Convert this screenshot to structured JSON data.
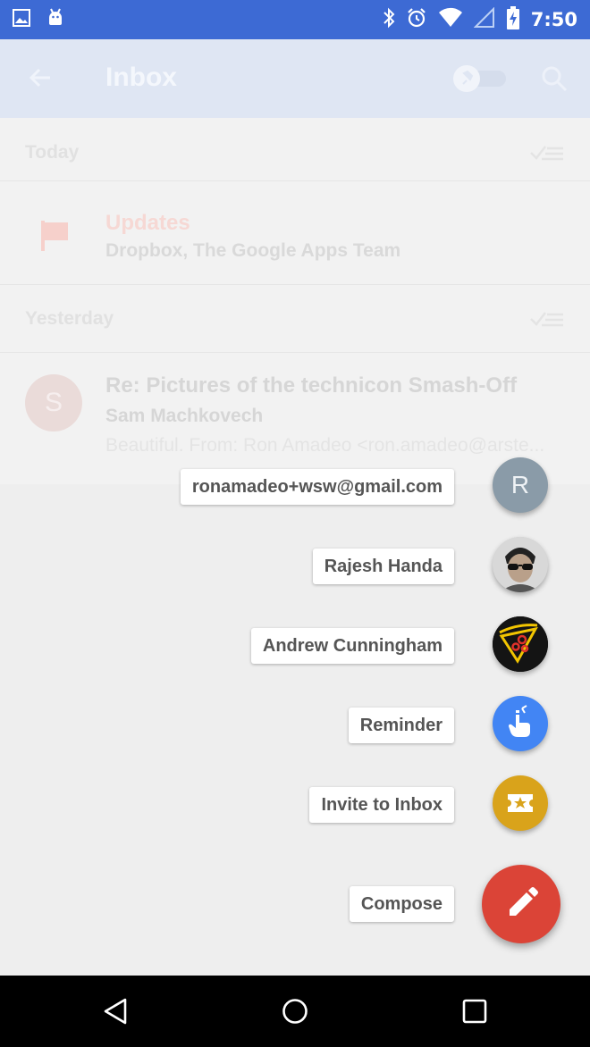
{
  "status_bar": {
    "time": "7:50"
  },
  "app_bar": {
    "title": "Inbox"
  },
  "list": {
    "today_label": "Today",
    "yesterday_label": "Yesterday",
    "bundle": {
      "title": "Updates",
      "subtitle": "Dropbox, The Google Apps Team"
    },
    "email": {
      "avatar_letter": "S",
      "subject": "Re: Pictures of the technicon Smash-Off",
      "sender": "Sam Machkovech",
      "snippet": "Beautiful. From: Ron Amadeo <ron.amadeo@arste..."
    }
  },
  "speed_dial": {
    "items": [
      {
        "label": "ronamadeo+wsw@gmail.com",
        "avatar_letter": "R",
        "color": "#8a9ba8"
      },
      {
        "label": "Rajesh Handa"
      },
      {
        "label": "Andrew Cunningham"
      },
      {
        "label": "Reminder",
        "color": "#4285f4"
      },
      {
        "label": "Invite to Inbox",
        "color": "#d9a31b"
      },
      {
        "label": "Compose",
        "color": "#db4437"
      }
    ]
  },
  "colors": {
    "status_bar": "#3d6ad4",
    "app_bar_dimmed": "#dfe6f3",
    "compose_fab": "#db4437"
  }
}
